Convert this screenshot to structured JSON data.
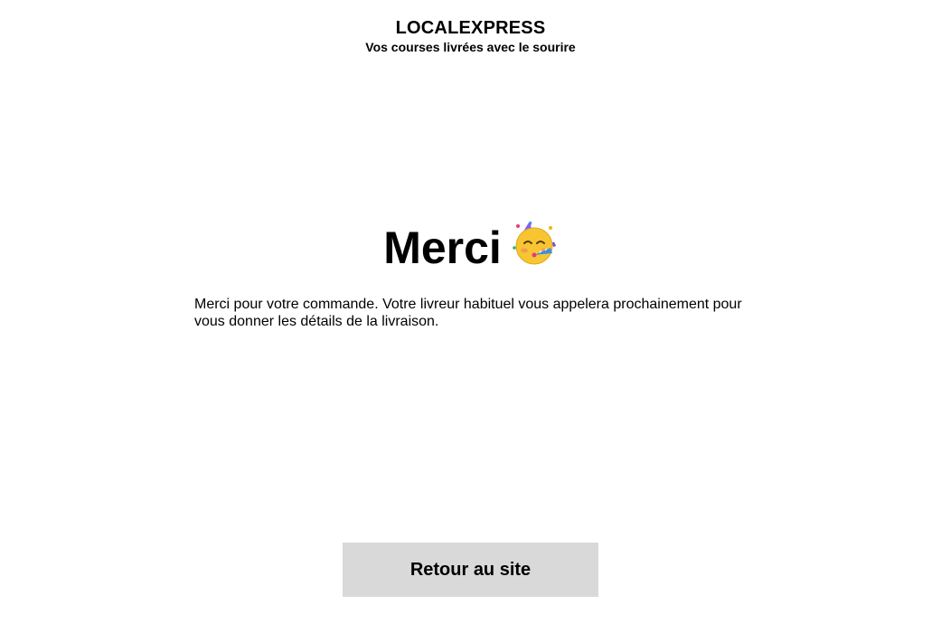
{
  "header": {
    "brand_name": "LOCALEXPRESS",
    "tagline": "Vos courses livrées avec le sourire"
  },
  "main": {
    "title": "Merci",
    "title_icon": "partying-face-icon",
    "message": "Merci pour votre commande. Votre livreur habituel vous appelera prochainement pour vous donner les détails de la livraison."
  },
  "footer": {
    "return_label": "Retour au site"
  },
  "colors": {
    "background": "#ffffff",
    "text": "#000000",
    "button_background": "#d9d9d9"
  }
}
